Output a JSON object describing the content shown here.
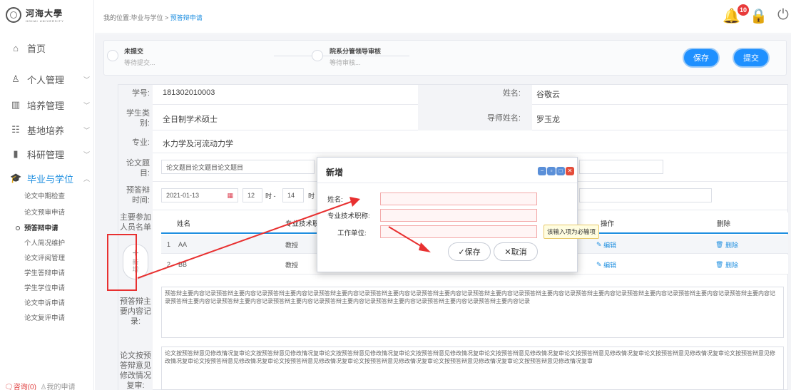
{
  "logo": {
    "cn": "河海大學",
    "en": "HOHAI UNIVERSITY"
  },
  "breadcrumb": {
    "prefix": "我的位置:毕业与学位 > ",
    "current": "预答辩申请"
  },
  "notifications": {
    "count": "10"
  },
  "nav": [
    {
      "label": "首页",
      "icon": "home-icon"
    },
    {
      "label": "个人管理",
      "icon": "person-icon"
    },
    {
      "label": "培养管理",
      "icon": "chart-icon"
    },
    {
      "label": "基地培养",
      "icon": "list-icon"
    },
    {
      "label": "科研管理",
      "icon": "bars-icon"
    },
    {
      "label": "毕业与学位",
      "icon": "graduation-cap-icon"
    }
  ],
  "subnav": [
    "论文中期检查",
    "论文预审申请",
    "预答辩申请",
    "个人简况维护",
    "论文评阅管理",
    "学生答辩申请",
    "学生学位申请",
    "论文申诉申请",
    "论文复评申请"
  ],
  "sidebar_footer": {
    "left": "咨询(0)",
    "right": "我的申请"
  },
  "steps": [
    {
      "title": "未提交",
      "sub": "等待提交..."
    },
    {
      "title": "院系分管领导审核",
      "sub": "等待审核..."
    }
  ],
  "buttons": {
    "save": "保存",
    "submit": "提交"
  },
  "form": {
    "student_id_label": "学号:",
    "student_id": "181302010003",
    "name_label": "姓名:",
    "name": "谷敬云",
    "type_label": "学生类别:",
    "type": "全日制学术硕士",
    "supervisor_label": "导师姓名:",
    "supervisor": "罗玉龙",
    "major_label": "专业:",
    "major": "水力学及河流动力学",
    "thesis_label": "论文题目:",
    "thesis": "论文题目论文题目论文题目",
    "time_label": "预答辩时间:",
    "date": "2021-01-13",
    "hour": "12",
    "hour_sep": "时 -",
    "hour2": "14",
    "hour2_sep": "时",
    "members_label": "主要参加人员名单",
    "add_label": "新增",
    "record_label": "预答辩主要内容记录:",
    "record_text": "预答辩主要内容记录预答辩主要内容记录预答辩主要内容记录预答辩主要内容记录预答辩主要内容记录预答辩主要内容记录预答辩主要内容记录预答辩主要内容记录预答辩主要内容记录预答辩主要内容记录预答辩主要内容记录预答辩主要内容记录预答辩主要内容记录预答辩主要内容记录预答辩主要内容记录预答辩主要内容记录预答辩主要内容记录预答辩主要内容记录预答辩主要内容记录",
    "revision_label": "论文按预答辩意见修改情况复审:",
    "revision_text": "论文按预答辩意见修改情况复审论文按预答辩意见修改情况复审论文按预答辩意见修改情况复审论文按预答辩意见修改情况复审论文按预答辩意见修改情况复审论文按预答辩意见修改情况复审论文按预答辩意见修改情况复审论文按预答辩意见修改情况复审论文按预答辩意见修改情况复审论文按预答辩意见修改情况复审论文按预答辩意见修改情况复审论文按预答辩意见修改情况复审论文按预答辩意见修改情况复审"
  },
  "table": {
    "headers": [
      "姓名",
      "专业技术职",
      "操作",
      "删除"
    ],
    "rows": [
      {
        "idx": "1",
        "name": "AA",
        "title": "教授",
        "edit": "编辑",
        "del": "删除"
      },
      {
        "idx": "2",
        "name": "BB",
        "title": "教授",
        "edit": "编辑",
        "del": "删除"
      }
    ]
  },
  "dialog": {
    "title": "新增",
    "name_label": "姓名:",
    "title_label": "专业技术职称:",
    "unit_label": "工作单位:",
    "tooltip": "该输入项为必输项",
    "save": "✓保存",
    "cancel": "✕取消"
  },
  "colors": {
    "accent": "#1e90ff",
    "annotation": "#e83030"
  }
}
